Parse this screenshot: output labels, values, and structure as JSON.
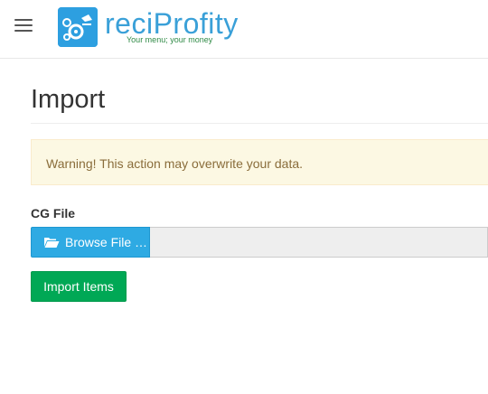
{
  "header": {
    "menu_icon": "hamburger-icon",
    "brand_name": "reciProfity",
    "tagline": "Your menu; your money",
    "logo_color": "#2d9fe0"
  },
  "page": {
    "title": "Import"
  },
  "alert": {
    "text": "Warning! This action may overwrite your data.",
    "background": "#fcf8e3",
    "text_color": "#8a6d3b"
  },
  "form": {
    "file_label": "CG File",
    "browse_label": "Browse File …",
    "browse_icon": "folder-open-icon",
    "file_value": "",
    "submit_label": "Import Items",
    "browse_color": "#2eaae3",
    "submit_color": "#00a855"
  }
}
